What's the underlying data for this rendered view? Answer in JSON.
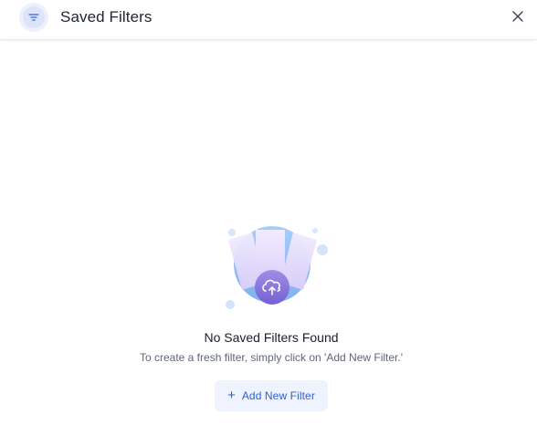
{
  "header": {
    "title": "Saved Filters",
    "icon": "filter-icon",
    "close_icon": "close-icon"
  },
  "empty_state": {
    "illustration": "cloud-upload-cards-illustration",
    "title": "No Saved Filters Found",
    "description": "To create a fresh filter, simply click on 'Add New Filter.'",
    "button_icon": "plus-icon",
    "button_plus": "+",
    "button_label": "Add New Filter"
  },
  "colors": {
    "accent": "#2f5fd0",
    "button_bg": "#eef3fd",
    "illustration_circle": "#9cc3f3",
    "illustration_cards": "#e6dcfb",
    "illustration_badge": "#8a72dd"
  }
}
